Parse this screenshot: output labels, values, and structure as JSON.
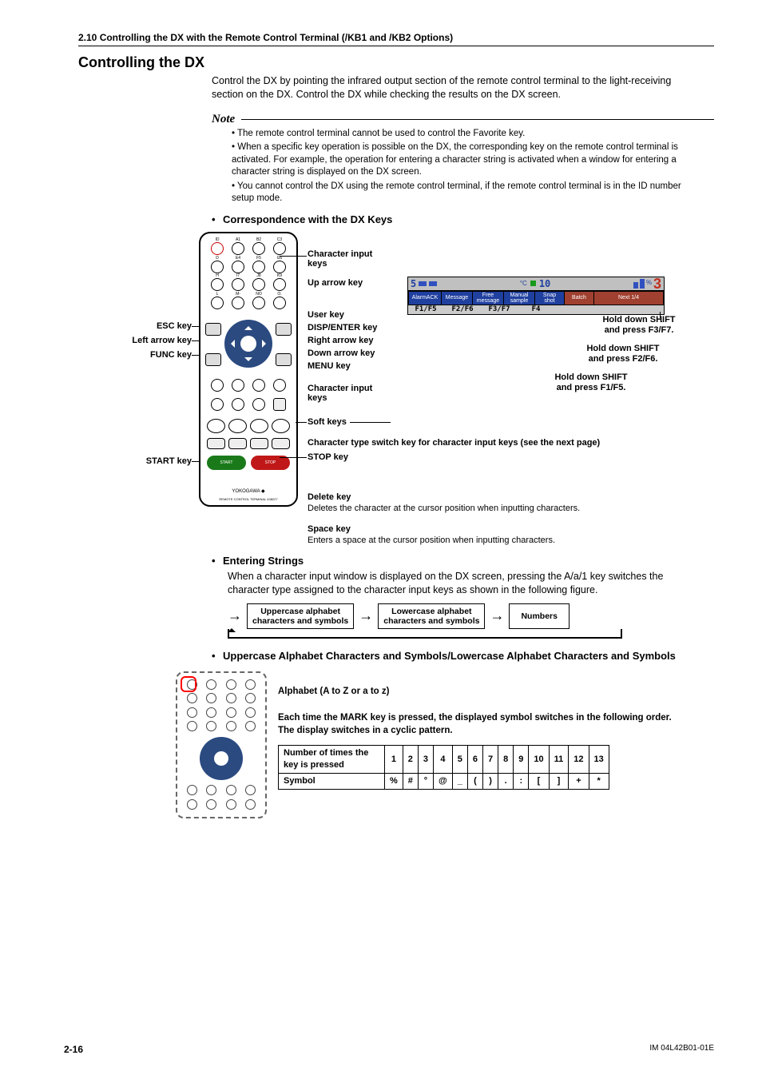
{
  "runhead": "2.10  Controlling the DX with the Remote Control Terminal (/KB1 and /KB2 Options)",
  "title": "Controlling the DX",
  "intro": "Control the DX by pointing the infrared output section of the remote control terminal to the light-receiving section on the DX. Control the DX while checking the results on the DX screen.",
  "note_label": "Note",
  "notes": [
    "The remote control terminal cannot be used to control the Favorite key.",
    "When a specific key operation is possible on the DX, the corresponding key on the remote control terminal is activated. For example, the operation for entering a character string is activated when a window for entering a character string is displayed on the DX screen.",
    "You cannot control the DX using the remote control terminal, if the remote control terminal is in the ID number setup mode."
  ],
  "sec_correspond": "Correspondence with the DX Keys",
  "remote_labels_left": {
    "esc": "ESC key",
    "left": "Left arrow key",
    "func": "FUNC key",
    "start": "START key"
  },
  "remote_labels_right": {
    "charin": "Character input\nkeys",
    "up": "Up arrow key",
    "user": "User key",
    "disp": "DISP/ENTER key",
    "right": "Right arrow key",
    "down": "Down arrow key",
    "menu": "MENU key",
    "charin2": "Character input\nkeys",
    "soft": "Soft keys",
    "typeswitch": "Character type switch key for character input keys (see the next page)",
    "stop": "STOP key",
    "delete_h": "Delete key",
    "delete_t": "Deletes the character at the cursor position when inputting characters.",
    "space_h": "Space key",
    "space_t": "Enters a space at the cursor position when inputting characters."
  },
  "dx": {
    "grp": "5",
    "unit": "°C",
    "id": "10",
    "pct": "%",
    "big": "3",
    "buttons": [
      "AlarmACK",
      "Message",
      "Free\nmessage",
      "Manual\nsample",
      "Snap\nshot",
      "Batch",
      "Next 1/4"
    ],
    "fkeys": [
      "F1/F5",
      "F2/F6",
      "F3/F7",
      "F4"
    ],
    "shift3": "Hold down SHIFT\nand press F3/F7.",
    "shift2": "Hold down SHIFT\nand press F2/F6.",
    "shift1": "Hold down SHIFT\nand press F1/F5."
  },
  "remote_brand": "YOKOGAWA ◆",
  "remote_sub": "REMOTE CONTROL TERMINAL  438227",
  "sec_entering": "Entering Strings",
  "entering_text": "When a character input window is displayed on the DX screen, pressing the A/a/1 key switches the character type assigned to the character input keys as shown in the following figure.",
  "cycle": {
    "a": "Uppercase alphabet\ncharacters and symbols",
    "b": "Lowercase alphabet\ncharacters and symbols",
    "c": "Numbers"
  },
  "sec_upper": "Uppercase Alphabet Characters and Symbols/Lowercase Alphabet Characters and Symbols",
  "alpha_line": "Alphabet (A to Z or a to z)",
  "mark_line1": "Each time the MARK key is pressed, the displayed symbol switches in the following order.",
  "mark_line2": "The display switches in a cyclic pattern.",
  "sym_header": "Number of times the key is pressed",
  "sym_row": "Symbol",
  "sym_cols": [
    "1",
    "2",
    "3",
    "4",
    "5",
    "6",
    "7",
    "8",
    "9",
    "10",
    "11",
    "12",
    "13"
  ],
  "sym_vals": [
    "%",
    "#",
    "°",
    "@",
    "_",
    "(",
    ")",
    ".",
    ":",
    "[",
    "]",
    "+",
    "*",
    "/"
  ],
  "footer_page": "2-16",
  "footer_doc": "IM 04L42B01-01E"
}
